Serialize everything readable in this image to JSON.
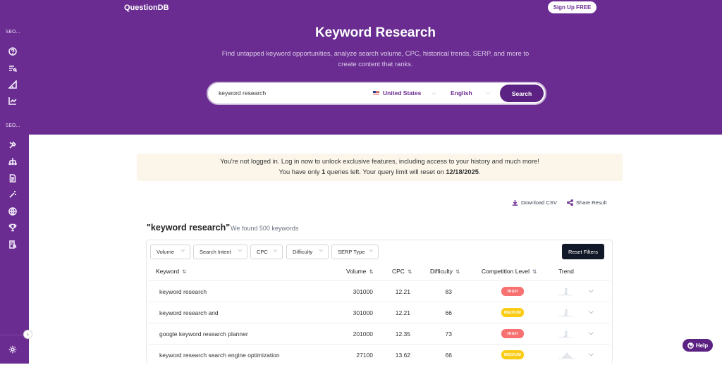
{
  "brand": "QuestionDB",
  "signup_label": "Sign Up FREE",
  "sidebar": {
    "section1": "SEO...",
    "section2": "SEO..."
  },
  "hero": {
    "title": "Keyword Research",
    "subtitle_line1": "Find untapped keyword opportunities, analyze search volume, CPC, historical trends, SERP, and more to",
    "subtitle_line2": "create content that ranks."
  },
  "search": {
    "value": "keyword research",
    "country": "United States",
    "language": "English",
    "button": "Search"
  },
  "notice": {
    "line1": "You're not logged in. Log in now to unlock exclusive features, including access to your history and much more!",
    "line2_pre": "You have only ",
    "queries_left": "1",
    "line2_mid": " queries left. Your query limit will reset on ",
    "reset_date": "12/18/2025",
    "line2_end": "."
  },
  "actions": {
    "download": "Download CSV",
    "share": "Share Result"
  },
  "results": {
    "query": "\"keyword research\"",
    "count_text": "We found 500 keywords"
  },
  "filters": [
    "Volume",
    "Search Intent",
    "CPC",
    "Difficulty",
    "SERP Type"
  ],
  "reset_label": "Reset Filters",
  "columns": {
    "keyword": "Keyword",
    "volume": "Volume",
    "cpc": "CPC",
    "difficulty": "Difficulty",
    "competition": "Competition Level",
    "trend": "Trend"
  },
  "rows": [
    {
      "keyword": "keyword research",
      "volume": "301000",
      "cpc": "12.21",
      "difficulty": "83",
      "competition": "HIGH"
    },
    {
      "keyword": "keyword research and",
      "volume": "301000",
      "cpc": "12.21",
      "difficulty": "66",
      "competition": "MEDIUM"
    },
    {
      "keyword": "google keyword research planner",
      "volume": "201000",
      "cpc": "12.35",
      "difficulty": "73",
      "competition": "HIGH"
    },
    {
      "keyword": "keyword research search engine optimization",
      "volume": "27100",
      "cpc": "13.62",
      "difficulty": "66",
      "competition": "MEDIUM"
    }
  ],
  "colors": {
    "brand_purple": "#6a2c91",
    "high": "#f87171",
    "medium": "#facc15"
  },
  "help_label": "Help"
}
